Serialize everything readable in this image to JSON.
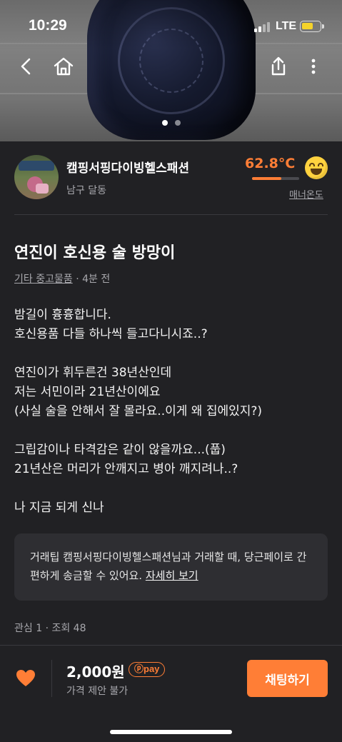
{
  "status_bar": {
    "time": "10:29",
    "network": "LTE",
    "battery_level": 0.65
  },
  "top_nav": {
    "back_icon": "chevron-left-icon",
    "home_icon": "home-icon",
    "share_icon": "share-icon",
    "more_icon": "more-vertical-icon"
  },
  "carousel": {
    "total": 2,
    "active": 1
  },
  "seller": {
    "name": "캠핑서핑다이빙헬스패션",
    "location": "남구 달동",
    "temperature": "62.8°C",
    "temperature_level": 0.628,
    "temperature_color": "#ff7e36",
    "manner_label": "매너온도"
  },
  "article": {
    "title": "연진이 호신용 술 방망이",
    "category": "기타 중고물품",
    "time_ago": "· 4분 전",
    "body": [
      "밤길이 흉흉합니다.",
      "호신용품 다들 하나씩 들고다니시죠..?",
      "",
      "연진이가 휘두른건 38년산인데",
      "저는 서민이라 21년산이에요",
      "(사실 술을 안해서 잘 몰라요..이게 왜 집에있지?)",
      "",
      "그립감이나 타격감은 같이 않을까요...(풉)",
      "21년산은 머리가 안깨지고 병아 깨지려나..?",
      "",
      "나 지금 되게 신나"
    ]
  },
  "tip": {
    "prefix": "거래팁",
    "text": " 캠핑서핑다이빙헬스패션님과 거래할 때, 당근페이로 간편하게 송금할 수 있어요. ",
    "link": "자세히 보기"
  },
  "stats": "관심 1 · 조회 48",
  "bottom_bar": {
    "price": "2,000원",
    "pay_badge": "pay",
    "negotiation": "가격 제안 불가",
    "chat_button": "채팅하기",
    "accent_color": "#ff7e36"
  }
}
